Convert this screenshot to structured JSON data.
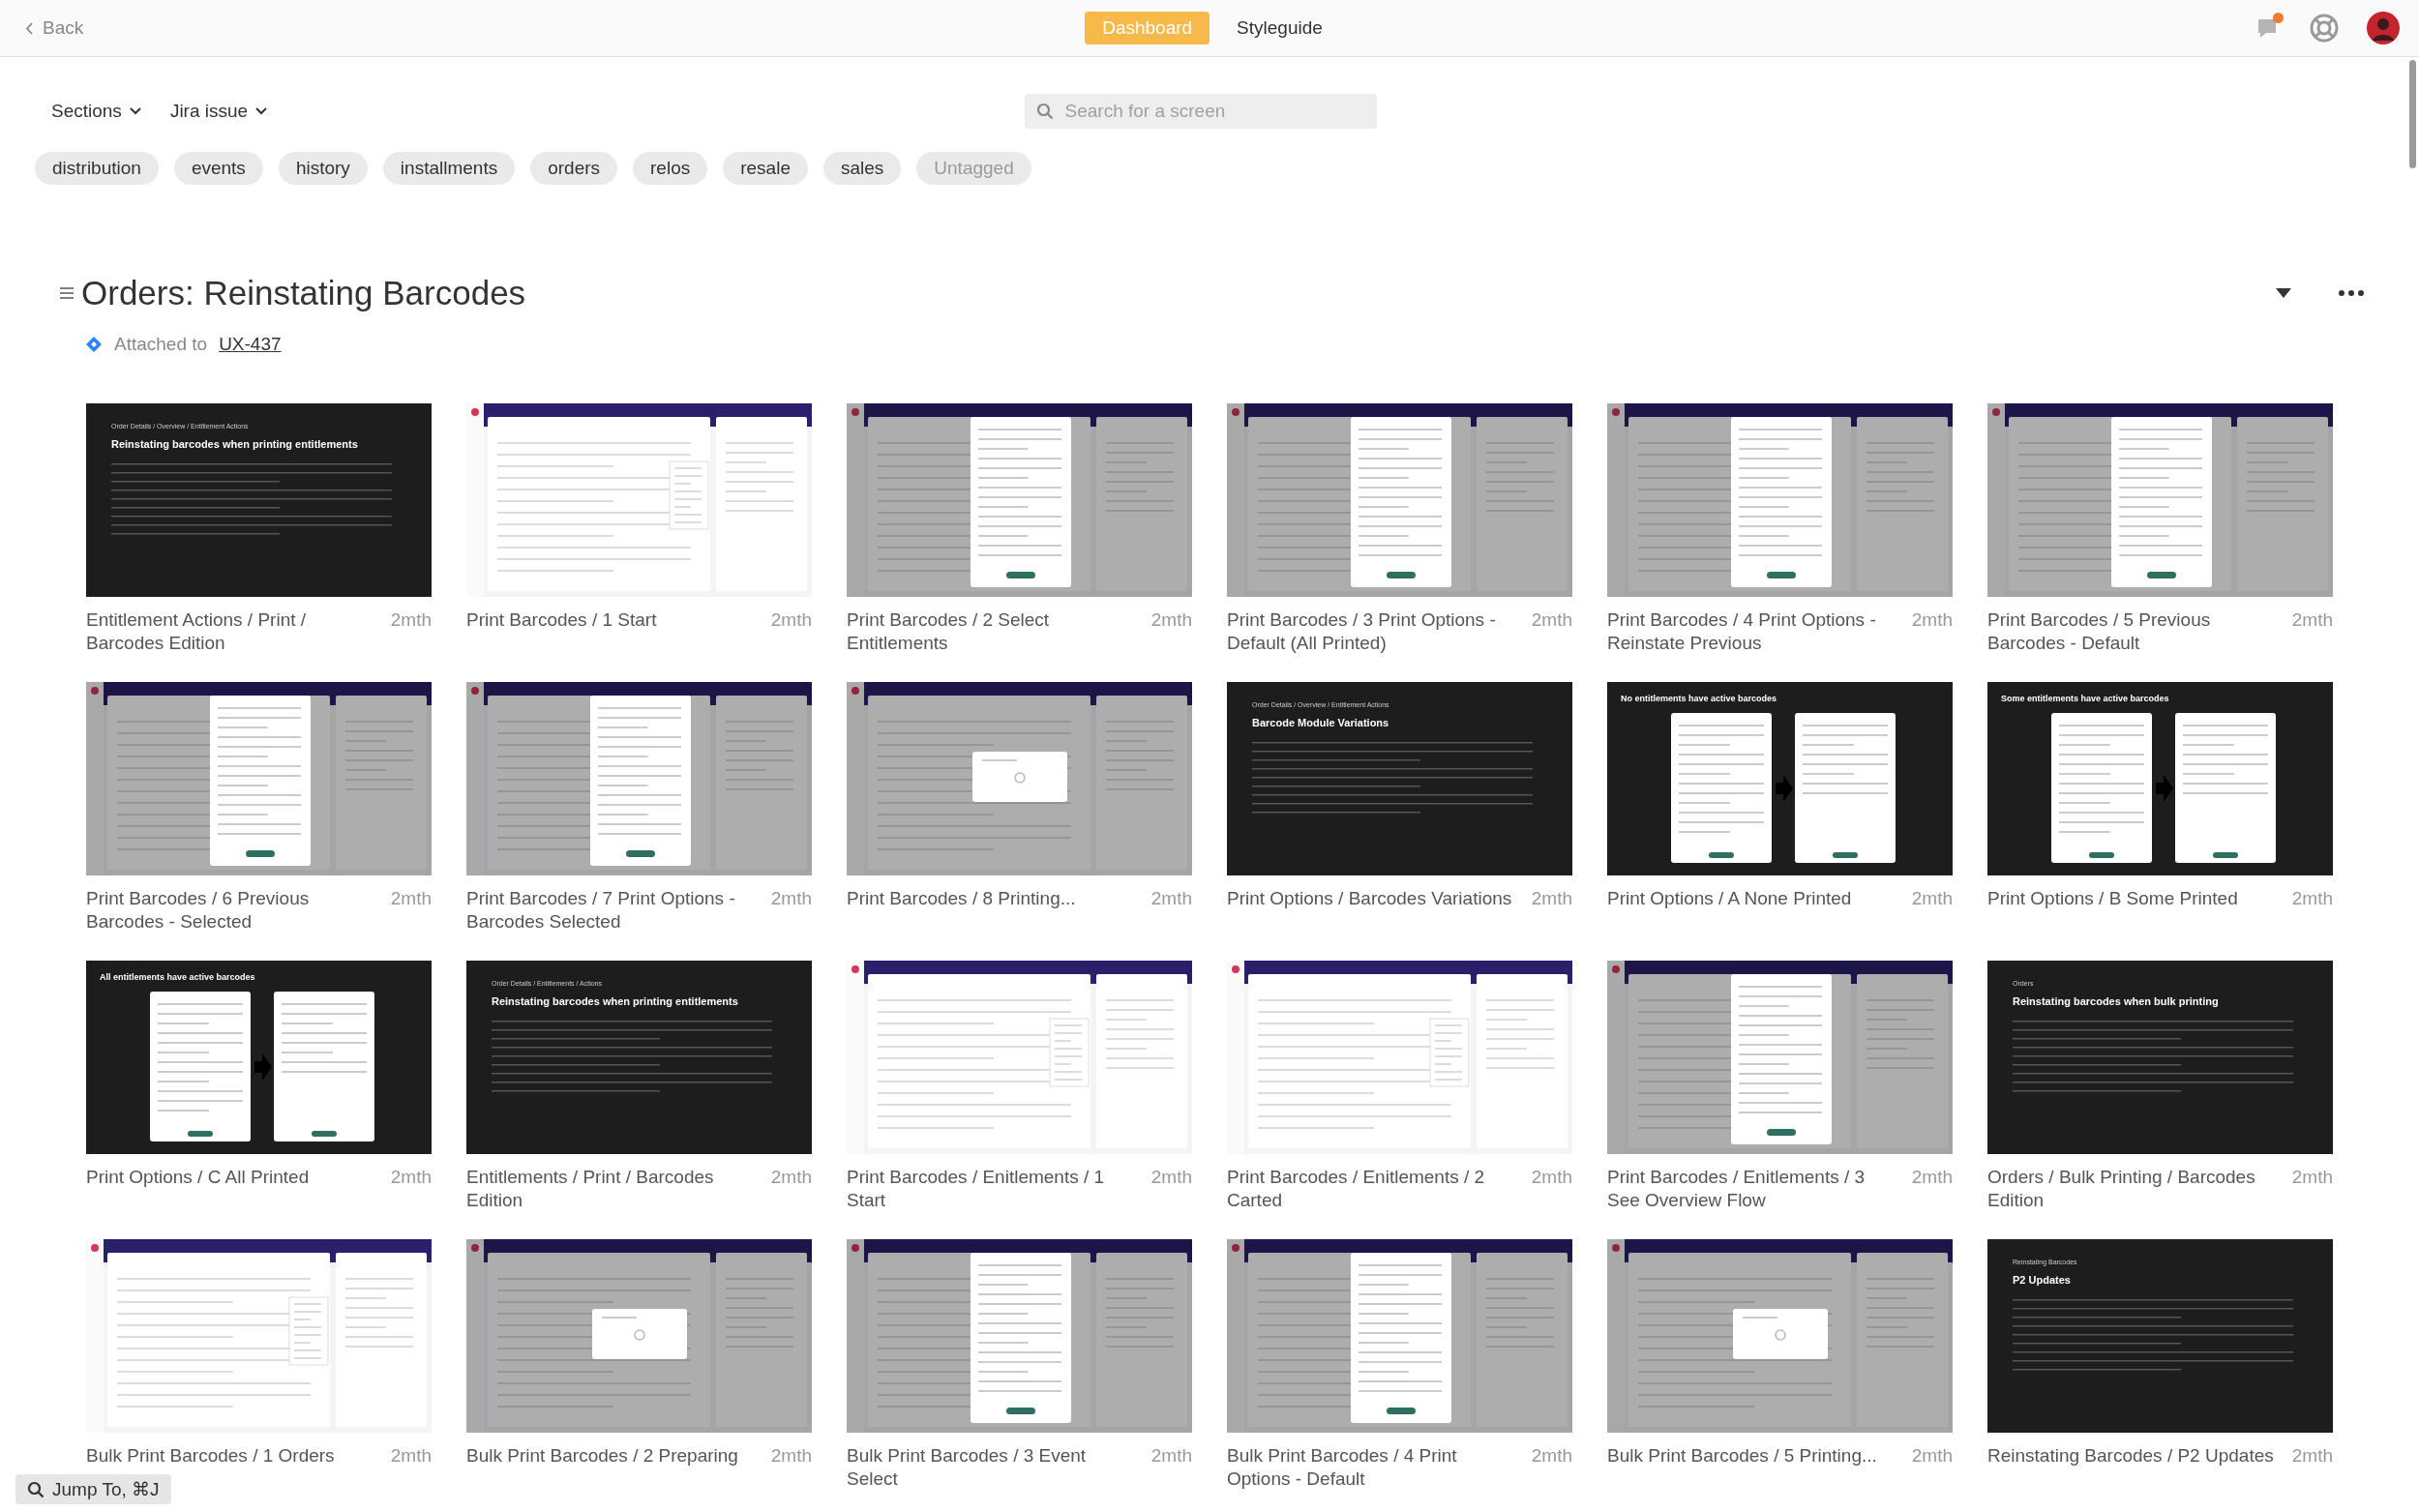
{
  "topbar": {
    "back": "Back",
    "tabs": [
      {
        "label": "Dashboard",
        "selected": true
      },
      {
        "label": "Styleguide",
        "selected": false
      }
    ],
    "notification_unread": true
  },
  "filters": [
    "Sections",
    "Jira issue"
  ],
  "search": {
    "placeholder": "Search for a screen"
  },
  "tags": [
    {
      "label": "distribution",
      "muted": false
    },
    {
      "label": "events",
      "muted": false
    },
    {
      "label": "history",
      "muted": false
    },
    {
      "label": "installments",
      "muted": false
    },
    {
      "label": "orders",
      "muted": false
    },
    {
      "label": "relos",
      "muted": false
    },
    {
      "label": "resale",
      "muted": false
    },
    {
      "label": "sales",
      "muted": false
    },
    {
      "label": "Untagged",
      "muted": true
    }
  ],
  "section": {
    "title": "Orders: Reinstating Barcodes",
    "attached_label": "Attached to",
    "issue": "UX-437"
  },
  "screens": [
    {
      "caption": "Entitlement Actions / Print / Barcodes Edition",
      "age": "2mth",
      "kind": "slide",
      "breadcrumb": "Order Details / Overview / Entitlement Actions",
      "heading": "Reinstating barcodes when printing entitlements"
    },
    {
      "caption": "Print Barcodes / 1 Start",
      "age": "2mth",
      "kind": "app"
    },
    {
      "caption": "Print Barcodes / 2 Select Entitlements",
      "age": "2mth",
      "kind": "modal"
    },
    {
      "caption": "Print Barcodes / 3 Print Options - Default (All Printed)",
      "age": "2mth",
      "kind": "modal"
    },
    {
      "caption": "Print Barcodes / 4 Print Options - Reinstate Previous",
      "age": "2mth",
      "kind": "modal"
    },
    {
      "caption": "Print Barcodes / 5 Previous Barcodes - Default",
      "age": "2mth",
      "kind": "modal"
    },
    {
      "caption": "Print Barcodes / 6 Previous Barcodes - Selected",
      "age": "2mth",
      "kind": "modal"
    },
    {
      "caption": "Print Barcodes / 7 Print Options - Barcodes Selected",
      "age": "2mth",
      "kind": "modal"
    },
    {
      "caption": "Print Barcodes / 8 Printing...",
      "age": "2mth",
      "kind": "loading"
    },
    {
      "caption": "Print Options / Barcodes Variations",
      "age": "2mth",
      "kind": "slide",
      "breadcrumb": "Order Details / Overview / Entitlement Actions",
      "heading": "Barcode Module Variations"
    },
    {
      "caption": "Print Options / A None Printed",
      "age": "2mth",
      "kind": "compare",
      "heading": "No entitlements have active barcodes"
    },
    {
      "caption": "Print Options / B Some Printed",
      "age": "2mth",
      "kind": "compare",
      "heading": "Some entitlements have active barcodes"
    },
    {
      "caption": "Print Options / C All Printed",
      "age": "2mth",
      "kind": "compare",
      "heading": "All entitlements have active barcodes"
    },
    {
      "caption": "Entitlements / Print / Barcodes Edition",
      "age": "2mth",
      "kind": "slide",
      "breadcrumb": "Order Details / Entitlements / Actions",
      "heading": "Reinstating barcodes when printing entitlements"
    },
    {
      "caption": "Print Barcodes / Enitlements / 1 Start",
      "age": "2mth",
      "kind": "app"
    },
    {
      "caption": "Print Barcodes / Enitlements / 2 Carted",
      "age": "2mth",
      "kind": "app"
    },
    {
      "caption": "Print Barcodes / Enitlements / 3 See Overview Flow",
      "age": "2mth",
      "kind": "modal"
    },
    {
      "caption": "Orders / Bulk Printing / Barcodes Edition",
      "age": "2mth",
      "kind": "slide",
      "breadcrumb": "Orders",
      "heading": "Reinstating barcodes when bulk printing"
    },
    {
      "caption": "Bulk Print Barcodes / 1 Orders",
      "age": "2mth",
      "kind": "app"
    },
    {
      "caption": "Bulk Print Barcodes / 2 Preparing",
      "age": "2mth",
      "kind": "loading"
    },
    {
      "caption": "Bulk Print Barcodes / 3 Event Select",
      "age": "2mth",
      "kind": "modal"
    },
    {
      "caption": "Bulk Print Barcodes / 4 Print Options - Default",
      "age": "2mth",
      "kind": "modal"
    },
    {
      "caption": "Bulk Print Barcodes / 5 Printing...",
      "age": "2mth",
      "kind": "loading"
    },
    {
      "caption": "Reinstating Barcodes / P2 Updates",
      "age": "2mth",
      "kind": "slide",
      "breadcrumb": "Reinstating Barcodes",
      "heading": "P2 Updates"
    }
  ],
  "jump": "Jump To, ⌘J"
}
